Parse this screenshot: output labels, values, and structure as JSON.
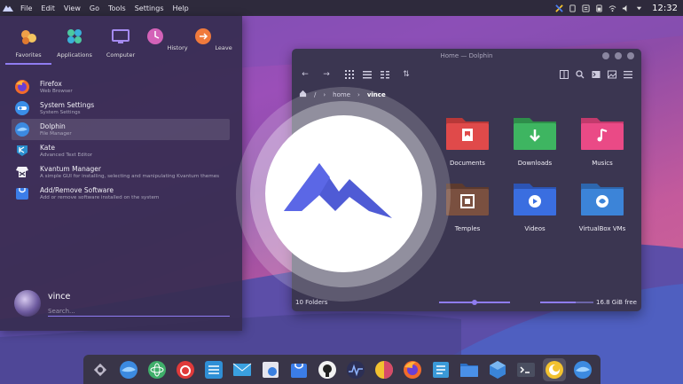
{
  "topbar": {
    "menu": [
      "File",
      "Edit",
      "View",
      "Go",
      "Tools",
      "Settings",
      "Help"
    ],
    "clock": "12:32",
    "tray_icons": [
      "kvantum-icon",
      "clipboard-icon",
      "notes-icon",
      "battery-icon",
      "wifi-icon",
      "volume-icon",
      "chevron-down-icon"
    ]
  },
  "launcher": {
    "categories": [
      {
        "label": "Favorites",
        "icon": "favorites-icon",
        "color": "#f0a048"
      },
      {
        "label": "Applications",
        "icon": "applications-icon",
        "color": "#4cc9a0"
      },
      {
        "label": "Computer",
        "icon": "computer-icon",
        "color": "#8b6fd6"
      },
      {
        "label": "History",
        "icon": "history-icon",
        "color": "#d462b8"
      },
      {
        "label": "Leave",
        "icon": "leave-icon",
        "color": "#f07a3c"
      }
    ],
    "apps": [
      {
        "name": "Firefox",
        "desc": "Web Browser",
        "icon": "firefox-icon"
      },
      {
        "name": "System Settings",
        "desc": "System Settings",
        "icon": "settings-icon"
      },
      {
        "name": "Dolphin",
        "desc": "File Manager",
        "icon": "dolphin-icon"
      },
      {
        "name": "Kate",
        "desc": "Advanced Text Editor",
        "icon": "kate-icon"
      },
      {
        "name": "Kvantum Manager",
        "desc": "A simple GUI for installing, selecting and manipulating Kvantum themes",
        "icon": "kvantum-icon"
      },
      {
        "name": "Add/Remove Software",
        "desc": "Add or remove software installed on the system",
        "icon": "discover-icon"
      }
    ],
    "user": "vince",
    "search_placeholder": "Search..."
  },
  "dolphin": {
    "title": "Home — Dolphin",
    "breadcrumb": [
      "/",
      "home",
      "vince"
    ],
    "folders": [
      {
        "label": "Documents",
        "color": "#e04a4a"
      },
      {
        "label": "Downloads",
        "color": "#3eb561"
      },
      {
        "label": "Musics",
        "color": "#ea4a86"
      },
      {
        "label": "Temples",
        "color": "#7a5040"
      },
      {
        "label": "Videos",
        "color": "#3a6ee0"
      },
      {
        "label": "VirtualBox VMs",
        "color": "#3c84d8"
      }
    ],
    "status": "10 Folders",
    "free": "16.8 GiB free",
    "zoom_level": 0.5,
    "disk_used_fraction": 0.67
  },
  "dock": {
    "icons": [
      "plasma-icon",
      "dolphin-icon",
      "atom-icon",
      "netease-music-icon",
      "settings-icon",
      "mail-icon",
      "screenshot-icon",
      "store-icon",
      "github-icon",
      "system-monitor-icon",
      "theme-icon",
      "firefox-icon",
      "notes-icon",
      "folder-icon",
      "virtualbox-icon",
      "terminal-icon",
      "ksnip-icon",
      "dolphin-icon"
    ]
  },
  "colors": {
    "accent": "#8f7cf0",
    "panel": "#2e2a3c",
    "window": "#3b3651"
  }
}
